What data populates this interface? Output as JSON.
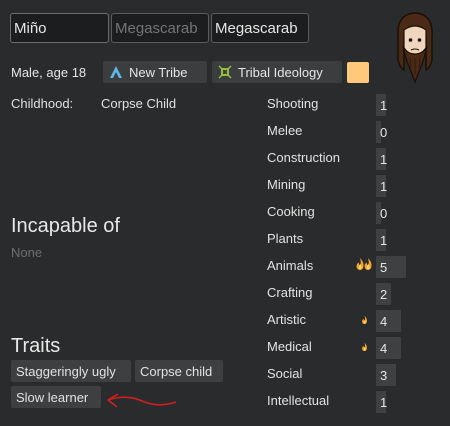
{
  "name": {
    "first": "Miño",
    "nick_placeholder": "Megascarab",
    "last": "Megascarab"
  },
  "bio": {
    "summary": "Male, age 18",
    "faction": "New Tribe",
    "ideology": "Tribal Ideology",
    "favorite_color": "#ffc87a"
  },
  "backstory": {
    "label": "Childhood:",
    "value": "Corpse Child"
  },
  "incapable": {
    "heading": "Incapable of",
    "value": "None"
  },
  "traits": {
    "heading": "Traits",
    "items": [
      "Staggeringly ugly",
      "Corpse child",
      "Slow learner"
    ]
  },
  "skills": [
    {
      "name": "Shooting",
      "level": 1,
      "passion": "none"
    },
    {
      "name": "Melee",
      "level": 0,
      "passion": "none"
    },
    {
      "name": "Construction",
      "level": 1,
      "passion": "none"
    },
    {
      "name": "Mining",
      "level": 1,
      "passion": "none"
    },
    {
      "name": "Cooking",
      "level": 0,
      "passion": "none"
    },
    {
      "name": "Plants",
      "level": 1,
      "passion": "none"
    },
    {
      "name": "Animals",
      "level": 5,
      "passion": "major"
    },
    {
      "name": "Crafting",
      "level": 2,
      "passion": "none"
    },
    {
      "name": "Artistic",
      "level": 4,
      "passion": "minor"
    },
    {
      "name": "Medical",
      "level": 4,
      "passion": "minor"
    },
    {
      "name": "Social",
      "level": 3,
      "passion": "none"
    },
    {
      "name": "Intellectual",
      "level": 1,
      "passion": "none"
    }
  ],
  "colors": {
    "annotation_arrow": "#d11f1f",
    "passion_flame": "#f2a22c"
  }
}
